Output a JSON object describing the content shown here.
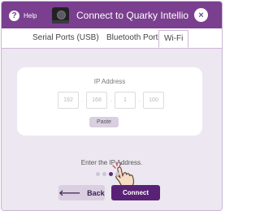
{
  "titlebar": {
    "help_label": "Help",
    "help_glyph": "?",
    "title": "Connect to Quarky Intellio",
    "close_glyph": "×",
    "device_icon": "device-icon"
  },
  "tabs": [
    {
      "label": "Serial Ports (USB)",
      "active": false
    },
    {
      "label": "Bluetooth Ports",
      "active": false
    },
    {
      "label": "Wi-Fi",
      "active": true
    }
  ],
  "card": {
    "ip_label": "IP Address",
    "ip_octets": [
      "192",
      "168",
      "1",
      "100"
    ],
    "separator": ".",
    "paste_label": "Paste"
  },
  "instruction": "Enter the IP Address.",
  "steps": {
    "total": 4,
    "current": 3
  },
  "buttons": {
    "back": "Back",
    "back_arrow": "🡐",
    "connect": "Connect"
  },
  "colors": {
    "brand_purple": "#7b3f8f",
    "content_bg": "#ece7f0",
    "connect_purple": "#5a2277",
    "back_bg": "#d9cfe0"
  }
}
